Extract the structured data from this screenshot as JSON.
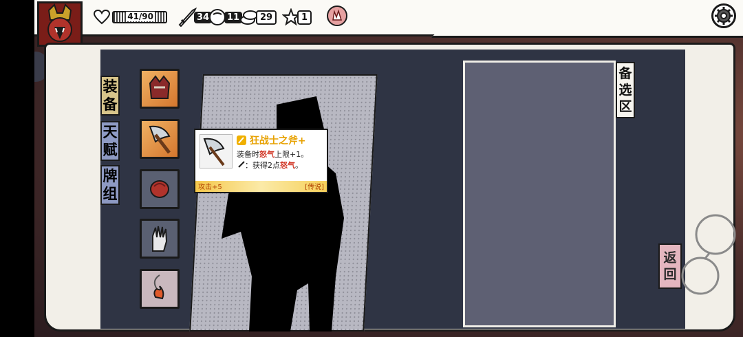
{
  "hud": {
    "hp": "41/90",
    "strength": "34",
    "armor": "11",
    "coins": "29",
    "stars": "1"
  },
  "tabs": {
    "equipment": [
      "装",
      "备"
    ],
    "talent": [
      "天",
      "赋"
    ],
    "deck": [
      "牌",
      "组"
    ]
  },
  "reserve_label": [
    "备",
    "选",
    "区"
  ],
  "return_label": [
    "返",
    "回"
  ],
  "tooltip": {
    "title": "狂战士之斧+",
    "line1_prefix": "装备时",
    "line1_keyword": "怒气",
    "line1_suffix": "上限+1。",
    "line2_prefix": "：获得2点",
    "line2_keyword": "怒气",
    "line2_suffix": "。",
    "attack": "攻击+5",
    "rarity": "[传说]"
  },
  "colors": {
    "tab_equipment": "#d7c48a",
    "tab_talent": "#8e9ac3",
    "tab_deck": "#8e9ac3",
    "title_gold": "#e7a100",
    "keyword_red": "#d23a2a"
  },
  "icons": {
    "health": "heart-icon",
    "strength": "sword-icon",
    "armor": "armor-icon",
    "coins": "coins-icon",
    "stars": "star-icon",
    "relic": "relic-icon",
    "settings": "gear-icon"
  }
}
